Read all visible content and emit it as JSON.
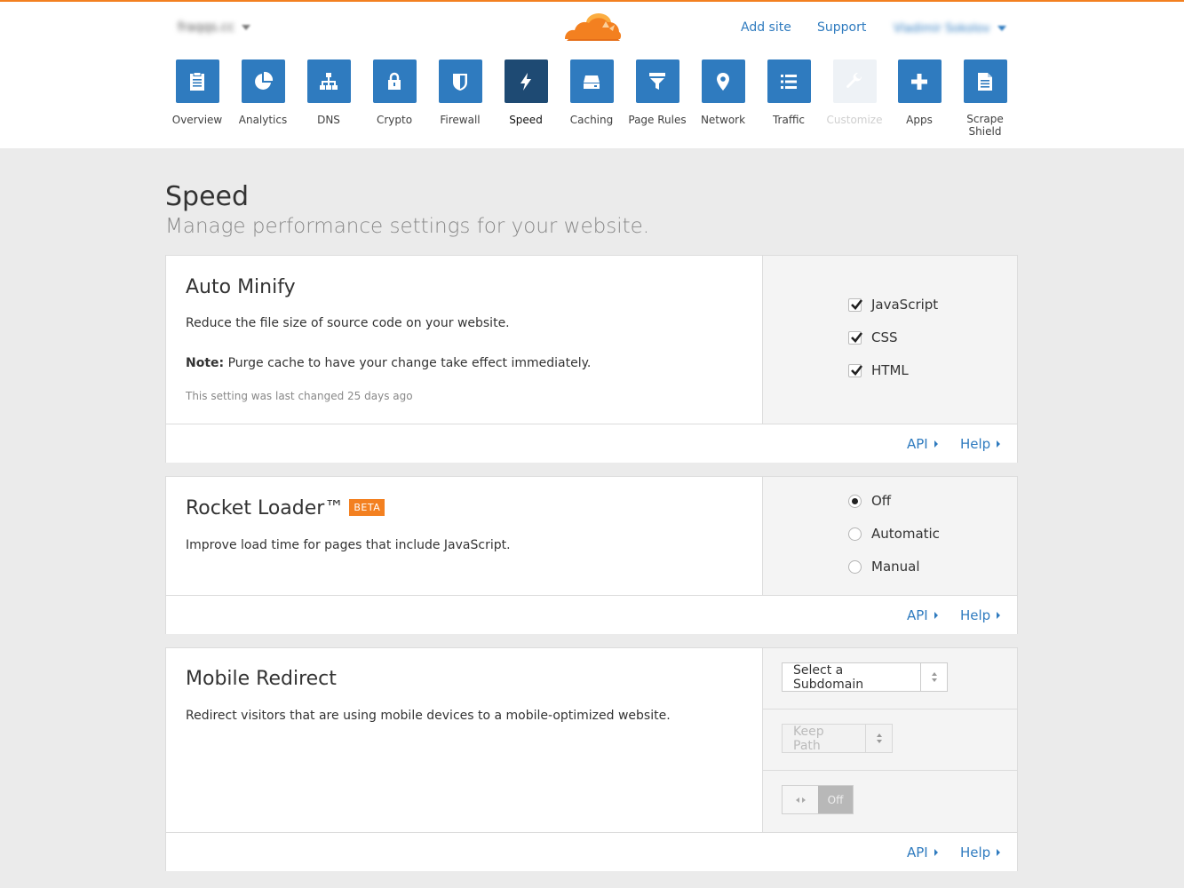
{
  "header": {
    "zone_name": "fraqqs.cc",
    "add_site": "Add site",
    "support": "Support",
    "user_name": "Vladimir Sokolov"
  },
  "nav": [
    {
      "label": "Overview",
      "icon": "clipboard-icon",
      "state": "normal"
    },
    {
      "label": "Analytics",
      "icon": "pie-chart-icon",
      "state": "normal"
    },
    {
      "label": "DNS",
      "icon": "network-tree-icon",
      "state": "normal"
    },
    {
      "label": "Crypto",
      "icon": "lock-icon",
      "state": "normal"
    },
    {
      "label": "Firewall",
      "icon": "shield-icon",
      "state": "normal"
    },
    {
      "label": "Speed",
      "icon": "lightning-icon",
      "state": "active"
    },
    {
      "label": "Caching",
      "icon": "drive-icon",
      "state": "normal"
    },
    {
      "label": "Page Rules",
      "icon": "filter-icon",
      "state": "normal"
    },
    {
      "label": "Network",
      "icon": "location-pin-icon",
      "state": "normal"
    },
    {
      "label": "Traffic",
      "icon": "list-icon",
      "state": "normal"
    },
    {
      "label": "Customize",
      "icon": "wrench-icon",
      "state": "disabled"
    },
    {
      "label": "Apps",
      "icon": "plus-icon",
      "state": "normal"
    },
    {
      "label": "Scrape Shield",
      "icon": "document-icon",
      "state": "normal"
    }
  ],
  "page": {
    "title": "Speed",
    "subtitle": "Manage performance settings for your website."
  },
  "auto_minify": {
    "title": "Auto Minify",
    "description": "Reduce the file size of source code on your website.",
    "note_label": "Note:",
    "note_text": " Purge cache to have your change take effect immediately.",
    "last_changed": "This setting was last changed 25 days ago",
    "options": [
      {
        "label": "JavaScript",
        "checked": true
      },
      {
        "label": "CSS",
        "checked": true
      },
      {
        "label": "HTML",
        "checked": true
      }
    ],
    "api": "API",
    "help": "Help"
  },
  "rocket_loader": {
    "title": "Rocket Loader™",
    "badge": "BETA",
    "description": "Improve load time for pages that include JavaScript.",
    "options": [
      {
        "label": "Off",
        "selected": true
      },
      {
        "label": "Automatic",
        "selected": false
      },
      {
        "label": "Manual",
        "selected": false
      }
    ],
    "api": "API",
    "help": "Help"
  },
  "mobile_redirect": {
    "title": "Mobile Redirect",
    "description": "Redirect visitors that are using mobile devices to a mobile-optimized website.",
    "subdomain_select": "Select a Subdomain",
    "path_select": "Keep Path",
    "toggle_state": "Off",
    "api": "API",
    "help": "Help"
  },
  "colors": {
    "accent_blue": "#2f7bbf",
    "active_tile": "#1e4a73",
    "brand_orange": "#f38020"
  }
}
